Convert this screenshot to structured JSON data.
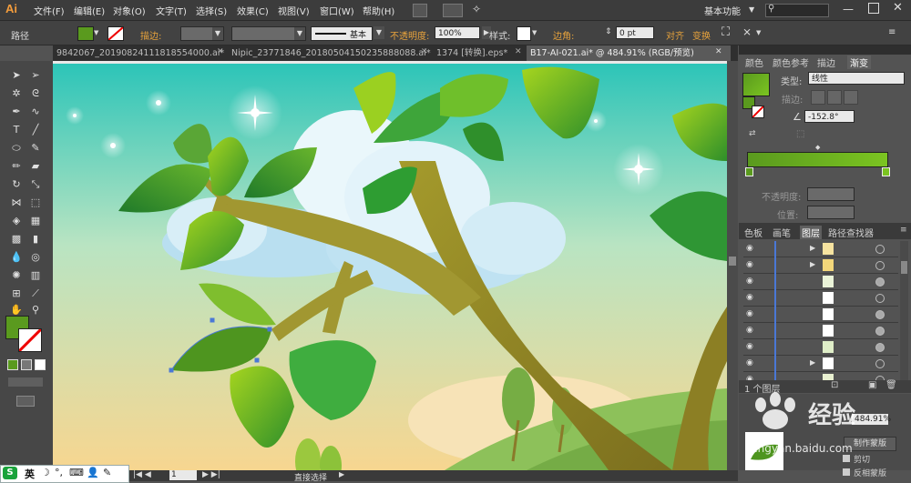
{
  "app": {
    "logo": "Ai",
    "workspace": "基本功能",
    "search_placeholder": ""
  },
  "menu": [
    "文件(F)",
    "编辑(E)",
    "对象(O)",
    "文字(T)",
    "选择(S)",
    "效果(C)",
    "视图(V)",
    "窗口(W)",
    "帮助(H)"
  ],
  "controlbar": {
    "selection_label": "路径",
    "stroke_label": "描边:",
    "stroke_style": "基本",
    "opacity_label": "不透明度:",
    "opacity_value": "100%",
    "style_label": "样式:",
    "corner_label": "边角:",
    "corner_value": "0 pt",
    "align_label": "对齐",
    "transform_label": "变换"
  },
  "tabs": [
    {
      "label": "9842067_20190824111818554000.ai*",
      "active": false
    },
    {
      "label": "Nipic_23771846_20180504150235888088.ai*",
      "active": false
    },
    {
      "label": "1374 [转换].eps*",
      "active": false
    },
    {
      "label": "B17-AI-021.ai* @ 484.91% (RGB/预览)",
      "active": true
    }
  ],
  "gradient_panel": {
    "tabs": [
      "颜色",
      "颜色参考",
      "描边",
      "渐变"
    ],
    "type_label": "类型:",
    "type_value": "线性",
    "stroke_label": "描边:",
    "angle_value": "-152.8°",
    "opacity_label": "不透明度:",
    "position_label": "位置:",
    "start_color": "#5a9a1e",
    "end_color": "#7bc421"
  },
  "layers_panel": {
    "tabs": [
      "色板",
      "画笔",
      "图层",
      "路径查找器"
    ],
    "row_count": 9,
    "footer": "1 个图层"
  },
  "status": {
    "zoom": "484.91%",
    "page": "1",
    "tool": "直接选择",
    "make_mask": "制作蒙版",
    "clip": "剪切",
    "invert_mask": "反相蒙版"
  },
  "taskbar": {
    "ime_label": "英"
  },
  "colors": {
    "accent": "#e8a33c",
    "fill": "#5a9a1e",
    "sky_top": "#2ac4b8",
    "sky_bottom": "#f7d690"
  },
  "icons": [
    "selection-tool-icon",
    "direct-selection-icon",
    "magic-wand-icon",
    "lasso-icon",
    "pen-icon",
    "type-icon",
    "line-icon",
    "ellipse-icon",
    "brush-icon",
    "pencil-icon",
    "rotate-icon",
    "scale-icon",
    "eyedropper-icon",
    "hand-icon",
    "zoom-icon",
    "search-icon",
    "eye-icon"
  ]
}
